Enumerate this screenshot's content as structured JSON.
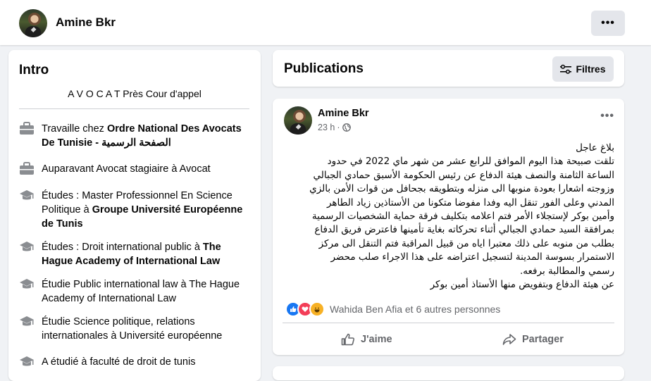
{
  "header": {
    "profile_name": "Amine Bkr",
    "more_icon": "more-dots-icon"
  },
  "intro": {
    "title": "Intro",
    "bio": "A V O C A T Près Cour d'appel",
    "items": [
      {
        "icon": "briefcase-icon",
        "prefix": "Travaille chez ",
        "bold": "Ordre National Des Avocats De Tunisie - الصفحة الرسمية",
        "suffix": ""
      },
      {
        "icon": "briefcase-icon",
        "prefix": "Auparavant Avocat stagiaire à Avocat",
        "bold": "",
        "suffix": ""
      },
      {
        "icon": "graduation-cap-icon",
        "prefix": "Études : Master Professionnel En Science Politique à ",
        "bold": "Groupe Université Européenne de Tunis",
        "suffix": ""
      },
      {
        "icon": "graduation-cap-icon",
        "prefix": "Études : Droit international public à ",
        "bold": "The Hague Academy of International Law",
        "suffix": ""
      },
      {
        "icon": "graduation-cap-icon",
        "prefix": "Étudie Public international law à The Hague Academy of International Law",
        "bold": "",
        "suffix": ""
      },
      {
        "icon": "graduation-cap-icon",
        "prefix": "Étudie Science politique, relations internationales à Université européenne",
        "bold": "",
        "suffix": ""
      },
      {
        "icon": "graduation-cap-icon",
        "prefix": "A étudié à faculté de droit de tunis",
        "bold": "",
        "suffix": ""
      }
    ]
  },
  "publications": {
    "title": "Publications",
    "filter_label": "Filtres"
  },
  "post": {
    "author": "Amine Bkr",
    "time": "23 h",
    "visibility_icon": "globe-icon",
    "text": "بلاغ عاجل\nتلقت صبيحة هذا اليوم الموافق للرابع عشر من شهر ماي 2022 في حدود\nالساعة الثامنة والنصف هيئة الدفاع عن رئيس الحكومة الأسبق حمادي الجبالي\nوزوجته اشعارا بعودة منوبها الى منزله وبتطويقه بجحافل من قوات الأمن بالزي\nالمدني وعلى الفور تنقل اليه وفدا مفوضا متكونا من الأستاذين زياد الطاهر\nوأمين بوكر لإستجلاء الأمر فتم اعلامه بتكليف فرقة حماية الشخصيات الرسمية\nبمرافقة السيد حمادي الجبالي أثناء تحركاته بغاية تأمينها فاعترض فريق الدفاع\nبطلب من منوبه على ذلك معتبرا اياه من قبيل المراقبة فتم التنقل الى مركز\nالاستمرار بسوسة المدينة لتسجيل اعتراضه على هذا الاجراء صلب محضر\nرسمي والمطالبة برفعه.\nعن هيئة الدفاع وبتفويض منها الأستاذ أمين بوكر",
    "reaction_icons": [
      "like-icon",
      "love-icon",
      "haha-icon"
    ],
    "reactions_summary": "Wahida Ben Afia et 6 autres personnes",
    "like_label": "J'aime",
    "share_label": "Partager"
  },
  "colors": {
    "accent": "#1877f2",
    "background": "#f0f2f5",
    "card": "#ffffff",
    "secondary_text": "#65676b"
  }
}
